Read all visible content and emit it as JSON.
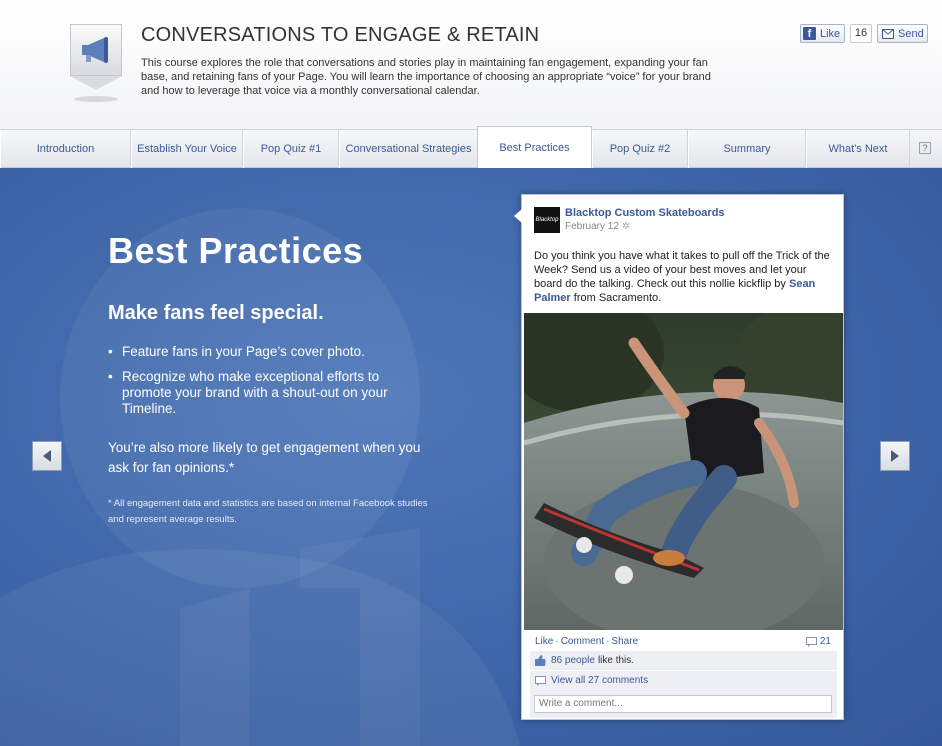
{
  "header": {
    "title": "CONVERSATIONS TO ENGAGE & RETAIN",
    "description": "This course explores the role that conversations and stories play in maintaining fan engagement, expanding your fan base, and retaining fans of your Page. You will learn the importance of choosing an appropriate “voice” for your brand and how to leverage that voice via a monthly conversational calendar.",
    "badge_icon": "megaphone-icon",
    "like_label": "Like",
    "like_count": "16",
    "send_label": "Send"
  },
  "tabs": [
    {
      "label": "Introduction"
    },
    {
      "label": "Establish Your Voice"
    },
    {
      "label": "Pop Quiz #1"
    },
    {
      "label": "Conversational Strategies"
    },
    {
      "label": "Best Practices",
      "active": true
    },
    {
      "label": "Pop Quiz #2"
    },
    {
      "label": "Summary"
    },
    {
      "label": "What's Next"
    }
  ],
  "help_label": "?",
  "slide": {
    "title": "Best Practices",
    "subtitle": "Make fans feel special.",
    "bullets": [
      "Feature fans in your Page’s cover photo.",
      "Recognize who make exceptional efforts to promote your brand with a shout-out on your Timeline."
    ],
    "engage_text": "You’re also more likely to get engagement when you ask for fan opinions.*",
    "footnote": "* All engagement data and statistics are based on internal Facebook studies and represent average results."
  },
  "post": {
    "avatar_text": "Blacktop",
    "page_name": "Blacktop Custom Skateboards",
    "date": "February 12",
    "text_before": "Do you think you have what it takes to pull off the Trick of the Week? Send us a video of your best moves and let your board do the talking. Check out this nollie kickflip by ",
    "mention": "Sean Palmer",
    "text_after": " from Sacramento.",
    "actions": {
      "like": "Like",
      "comment": "Comment",
      "share": "Share"
    },
    "comment_count": "21",
    "likes_link": "86 people",
    "likes_suffix": "like this.",
    "view_comments": "View all 27 comments",
    "comment_placeholder": "Write a comment..."
  },
  "colors": {
    "brand": "#3b5998",
    "stage": "#3e66a8"
  }
}
